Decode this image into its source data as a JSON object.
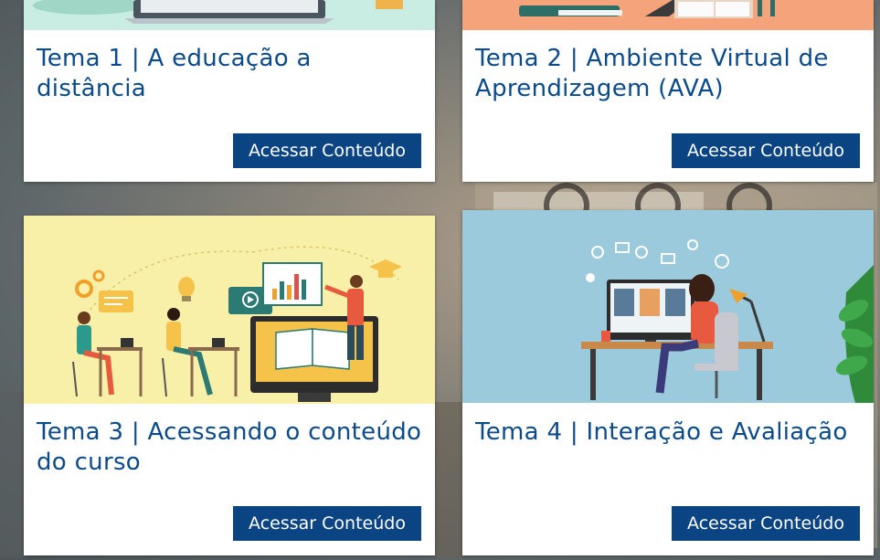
{
  "cards": [
    {
      "title": "Tema 1 | A educação a distância",
      "button": "Acessar Conteúdo"
    },
    {
      "title": "Tema 2 | Ambiente Virtual de Aprendizagem (AVA)",
      "button": "Acessar Conteúdo"
    },
    {
      "title": "Tema 3 | Acessando o conteúdo do curso",
      "button": "Acessar Conteúdo"
    },
    {
      "title": "Tema 4 | Interação e Avaliação",
      "button": "Acessar Conteúdo"
    }
  ],
  "colors": {
    "title": "#0b4a8b",
    "button": "#0b4482",
    "tema1_art": "#c9ede3",
    "tema2_art": "#f5a37a",
    "tema3_art": "#f8f0a8",
    "tema4_art": "#9ccadd"
  }
}
